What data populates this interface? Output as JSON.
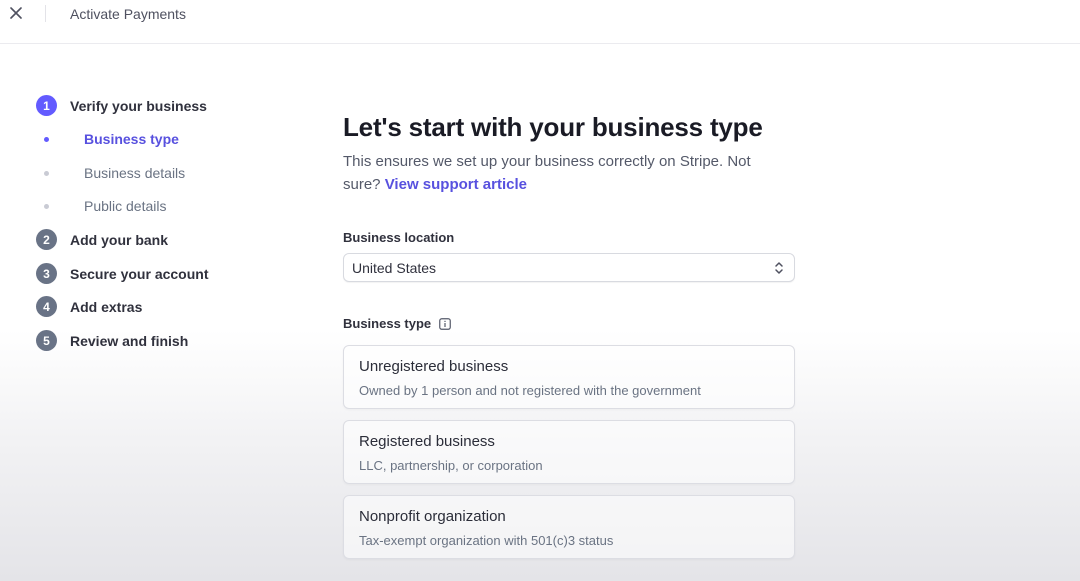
{
  "topbar": {
    "close_icon": "close-icon",
    "title": "Activate Payments"
  },
  "sidebar": {
    "steps": [
      {
        "number": "1",
        "label": "Verify your business",
        "active": true
      },
      {
        "number": "2",
        "label": "Add your bank",
        "active": false
      },
      {
        "number": "3",
        "label": "Secure your account",
        "active": false
      },
      {
        "number": "4",
        "label": "Add extras",
        "active": false
      },
      {
        "number": "5",
        "label": "Review and finish",
        "active": false
      }
    ],
    "substeps": [
      {
        "label": "Business type",
        "active": true
      },
      {
        "label": "Business details",
        "active": false
      },
      {
        "label": "Public details",
        "active": false
      }
    ]
  },
  "main": {
    "title": "Let's start with your business type",
    "description": "This ensures we set up your business correctly on Stripe. Not sure?",
    "support_link": "View support article",
    "location": {
      "label": "Business location",
      "value": "United States"
    },
    "business_type": {
      "label": "Business type",
      "options": [
        {
          "title": "Unregistered business",
          "description": "Owned by 1 person and not registered with the government"
        },
        {
          "title": "Registered business",
          "description": "LLC, partnership, or corporation"
        },
        {
          "title": "Nonprofit organization",
          "description": "Tax-exempt organization with 501(c)3 status"
        }
      ]
    }
  },
  "colors": {
    "accent": "#635bff",
    "link": "#5851df",
    "step_inactive": "#697386"
  }
}
